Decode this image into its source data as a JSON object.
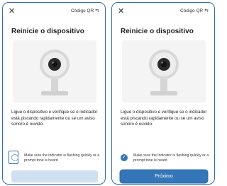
{
  "screens": [
    {
      "close_icon": "close-icon",
      "qr_label": "Código QR",
      "qr_icon": "⇆",
      "title": "Reinicie o dispositivo",
      "description": "Ligue o dispositivo e verifique se o indicador está piscando rapidamente ou se um aviso sonoro é ouvido.",
      "checkbox_label": "Make sure the indicator is flashing quickly or a prompt tone is heard",
      "checkbox_checked": false,
      "next_label": "Próximo",
      "next_enabled": false
    },
    {
      "close_icon": "close-icon",
      "qr_label": "Código QR",
      "qr_icon": "⇆",
      "title": "Reinicie o dispositivo",
      "description": "Ligue o dispositivo e verifique se o indicador está piscando rapidamente ou se um aviso sonoro é ouvido.",
      "checkbox_label": "Make sure the indicator is flashing quickly or a prompt tone is heard",
      "checkbox_checked": true,
      "next_label": "Próximo",
      "next_enabled": true
    }
  ],
  "colors": {
    "accent": "#3576b8",
    "accent_disabled": "#cfe0f3",
    "frame": "#2f6fb3"
  }
}
